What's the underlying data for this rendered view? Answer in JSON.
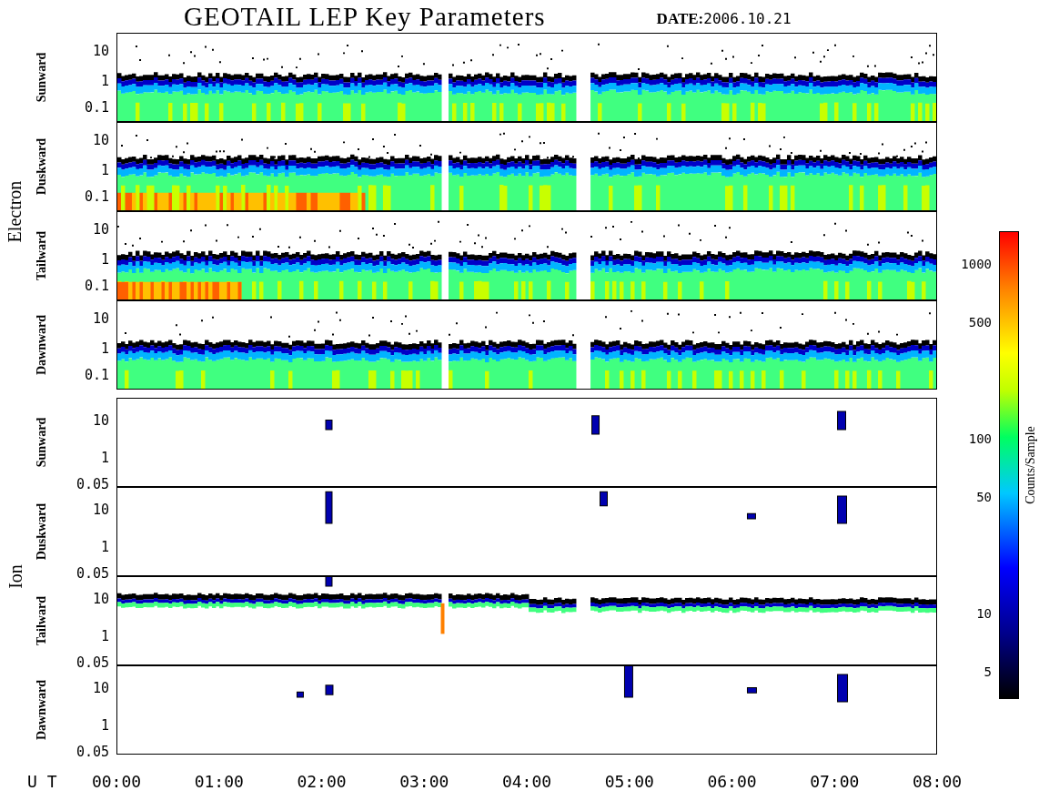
{
  "title": "GEOTAIL LEP Key Parameters",
  "date": {
    "label": "DATE:",
    "value": "2006.10.21"
  },
  "groups": [
    {
      "name": "Electron",
      "kind": "electron",
      "panels": [
        {
          "label": "Sunward",
          "yticks": [
            "10",
            "1",
            "0.1"
          ]
        },
        {
          "label": "Duskward",
          "yticks": [
            "10",
            "1",
            "0.1"
          ]
        },
        {
          "label": "Tailward",
          "yticks": [
            "10",
            "1",
            "0.1"
          ]
        },
        {
          "label": "Dawnward",
          "yticks": [
            "10",
            "1",
            "0.1"
          ]
        }
      ]
    },
    {
      "name": "Ion",
      "kind": "ion",
      "panels": [
        {
          "label": "Sunward",
          "yticks": [
            "10",
            "1",
            "0.05"
          ]
        },
        {
          "label": "Duskward",
          "yticks": [
            "10",
            "1",
            "0.05"
          ]
        },
        {
          "label": "Tailward",
          "yticks": [
            "10",
            "1",
            "0.05"
          ]
        },
        {
          "label": "Dawnward",
          "yticks": [
            "10",
            "1",
            "0.05"
          ]
        }
      ]
    }
  ],
  "x_axis": {
    "label": "U T",
    "ticks": [
      "00:00",
      "01:00",
      "02:00",
      "03:00",
      "04:00",
      "05:00",
      "06:00",
      "07:00",
      "08:00"
    ]
  },
  "colorbar": {
    "label": "Counts/Sample",
    "ticks": [
      "1000",
      "500",
      "100",
      "50",
      "10",
      "5"
    ]
  }
}
